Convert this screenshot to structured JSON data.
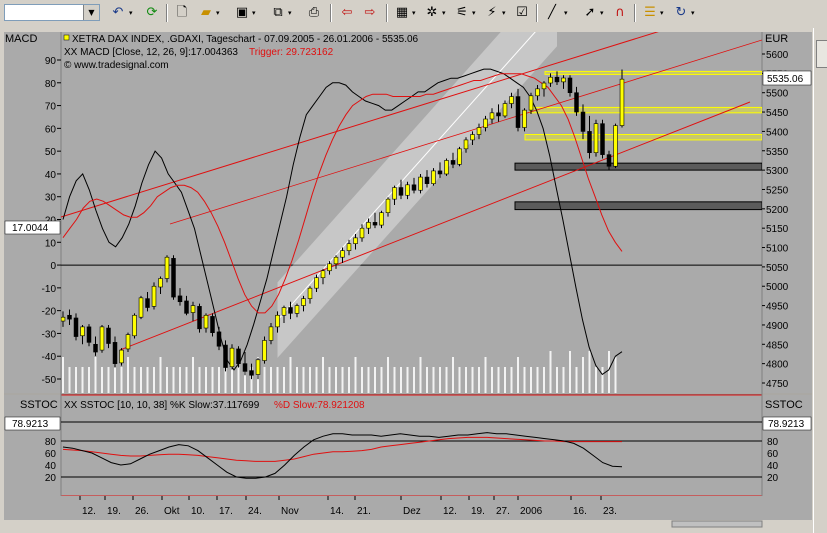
{
  "toolbar": {
    "icons": [
      "undo-icon",
      "refresh-icon",
      "new-document-icon",
      "open-folder-icon",
      "save-disk-icon",
      "copy-icon",
      "print-icon",
      "back-arrow-icon",
      "forward-arrow-icon",
      "chart-type-icon",
      "indicator-icon",
      "drawing-icon",
      "cursor-icon",
      "magnet-icon",
      "options-icon",
      "rotate-icon"
    ]
  },
  "chart_data": [
    {
      "type": "candlestick",
      "title": "XETRA DAX INDEX, .GDAXI, Tageschart - 07.09.2005 - 26.01.2006 - 5535.06",
      "subtitle": "XX MACD [Close, 12, 26, 9]:17.004363",
      "trigger_label": "Trigger: 29.723162",
      "watermark": "© www.tradesignal.com",
      "left_axis_label": "MACD",
      "right_axis_label": "EUR",
      "last_price_label": "5535.06",
      "macd_value_label": "17.0044",
      "left_ticks": [
        "90",
        "80",
        "70",
        "60",
        "50",
        "40",
        "30",
        "20",
        "10",
        "0",
        "-10",
        "-20",
        "-30",
        "-40",
        "-50"
      ],
      "right_ticks": [
        "5600",
        "5550",
        "5500",
        "5450",
        "5400",
        "5350",
        "5300",
        "5250",
        "5200",
        "5150",
        "5100",
        "5050",
        "5000",
        "4950",
        "4900",
        "4850",
        "4800",
        "4750"
      ],
      "ylim_price": [
        4730,
        5620
      ],
      "ylim_macd": [
        -54,
        95
      ],
      "colors": {
        "up": "#ffff00",
        "down": "#000000",
        "macd": "#000000",
        "trigger": "#e01010",
        "trend": "#e01010",
        "channel": "#ffffff",
        "yellow_zone": "#ffff00",
        "dark_zone": "#404040"
      },
      "candles": [
        {
          "o": 4910,
          "h": 4935,
          "l": 4895,
          "c": 4920
        },
        {
          "o": 4925,
          "h": 4940,
          "l": 4900,
          "c": 4915
        },
        {
          "o": 4918,
          "h": 4930,
          "l": 4860,
          "c": 4870
        },
        {
          "o": 4872,
          "h": 4900,
          "l": 4850,
          "c": 4895
        },
        {
          "o": 4895,
          "h": 4902,
          "l": 4845,
          "c": 4855
        },
        {
          "o": 4850,
          "h": 4870,
          "l": 4820,
          "c": 4830
        },
        {
          "o": 4835,
          "h": 4900,
          "l": 4828,
          "c": 4895
        },
        {
          "o": 4892,
          "h": 4900,
          "l": 4840,
          "c": 4852
        },
        {
          "o": 4855,
          "h": 4870,
          "l": 4790,
          "c": 4800
        },
        {
          "o": 4802,
          "h": 4840,
          "l": 4795,
          "c": 4835
        },
        {
          "o": 4838,
          "h": 4880,
          "l": 4830,
          "c": 4875
        },
        {
          "o": 4872,
          "h": 4930,
          "l": 4865,
          "c": 4925
        },
        {
          "o": 4920,
          "h": 4975,
          "l": 4915,
          "c": 4970
        },
        {
          "o": 4968,
          "h": 4985,
          "l": 4935,
          "c": 4945
        },
        {
          "o": 4948,
          "h": 5010,
          "l": 4940,
          "c": 5000
        },
        {
          "o": 4998,
          "h": 5025,
          "l": 4980,
          "c": 5020
        },
        {
          "o": 5020,
          "h": 5080,
          "l": 5010,
          "c": 5075
        },
        {
          "o": 5072,
          "h": 5080,
          "l": 4965,
          "c": 4972
        },
        {
          "o": 4975,
          "h": 4995,
          "l": 4950,
          "c": 4960
        },
        {
          "o": 4962,
          "h": 4975,
          "l": 4925,
          "c": 4930
        },
        {
          "o": 4932,
          "h": 4960,
          "l": 4910,
          "c": 4950
        },
        {
          "o": 4948,
          "h": 4955,
          "l": 4880,
          "c": 4890
        },
        {
          "o": 4892,
          "h": 4930,
          "l": 4880,
          "c": 4925
        },
        {
          "o": 4922,
          "h": 4930,
          "l": 4870,
          "c": 4880
        },
        {
          "o": 4882,
          "h": 4895,
          "l": 4835,
          "c": 4845
        },
        {
          "o": 4848,
          "h": 4860,
          "l": 4780,
          "c": 4790
        },
        {
          "o": 4792,
          "h": 4850,
          "l": 4785,
          "c": 4840
        },
        {
          "o": 4838,
          "h": 4845,
          "l": 4790,
          "c": 4800
        },
        {
          "o": 4800,
          "h": 4830,
          "l": 4770,
          "c": 4780
        },
        {
          "o": 4782,
          "h": 4800,
          "l": 4760,
          "c": 4770
        },
        {
          "o": 4772,
          "h": 4815,
          "l": 4760,
          "c": 4810
        },
        {
          "o": 4808,
          "h": 4870,
          "l": 4800,
          "c": 4860
        },
        {
          "o": 4860,
          "h": 4905,
          "l": 4850,
          "c": 4895
        },
        {
          "o": 4895,
          "h": 4935,
          "l": 4880,
          "c": 4925
        },
        {
          "o": 4925,
          "h": 4950,
          "l": 4905,
          "c": 4945
        },
        {
          "o": 4945,
          "h": 4960,
          "l": 4915,
          "c": 4930
        },
        {
          "o": 4930,
          "h": 4955,
          "l": 4920,
          "c": 4950
        },
        {
          "o": 4950,
          "h": 4975,
          "l": 4935,
          "c": 4968
        },
        {
          "o": 4968,
          "h": 5000,
          "l": 4955,
          "c": 4995
        },
        {
          "o": 4995,
          "h": 5030,
          "l": 4985,
          "c": 5022
        },
        {
          "o": 5022,
          "h": 5045,
          "l": 5005,
          "c": 5040
        },
        {
          "o": 5040,
          "h": 5065,
          "l": 5030,
          "c": 5058
        },
        {
          "o": 5058,
          "h": 5080,
          "l": 5045,
          "c": 5075
        },
        {
          "o": 5075,
          "h": 5100,
          "l": 5060,
          "c": 5092
        },
        {
          "o": 5092,
          "h": 5120,
          "l": 5080,
          "c": 5110
        },
        {
          "o": 5110,
          "h": 5135,
          "l": 5095,
          "c": 5125
        },
        {
          "o": 5125,
          "h": 5160,
          "l": 5115,
          "c": 5150
        },
        {
          "o": 5150,
          "h": 5175,
          "l": 5135,
          "c": 5165
        },
        {
          "o": 5165,
          "h": 5190,
          "l": 5150,
          "c": 5158
        },
        {
          "o": 5158,
          "h": 5195,
          "l": 5150,
          "c": 5190
        },
        {
          "o": 5190,
          "h": 5230,
          "l": 5180,
          "c": 5225
        },
        {
          "o": 5225,
          "h": 5260,
          "l": 5210,
          "c": 5255
        },
        {
          "o": 5255,
          "h": 5275,
          "l": 5225,
          "c": 5235
        },
        {
          "o": 5235,
          "h": 5270,
          "l": 5225,
          "c": 5262
        },
        {
          "o": 5262,
          "h": 5280,
          "l": 5240,
          "c": 5248
        },
        {
          "o": 5248,
          "h": 5290,
          "l": 5240,
          "c": 5282
        },
        {
          "o": 5282,
          "h": 5300,
          "l": 5255,
          "c": 5265
        },
        {
          "o": 5265,
          "h": 5305,
          "l": 5260,
          "c": 5298
        },
        {
          "o": 5298,
          "h": 5320,
          "l": 5280,
          "c": 5290
        },
        {
          "o": 5290,
          "h": 5330,
          "l": 5285,
          "c": 5325
        },
        {
          "o": 5325,
          "h": 5345,
          "l": 5305,
          "c": 5315
        },
        {
          "o": 5315,
          "h": 5360,
          "l": 5310,
          "c": 5355
        },
        {
          "o": 5355,
          "h": 5385,
          "l": 5345,
          "c": 5378
        },
        {
          "o": 5378,
          "h": 5400,
          "l": 5365,
          "c": 5392
        },
        {
          "o": 5392,
          "h": 5420,
          "l": 5380,
          "c": 5410
        },
        {
          "o": 5410,
          "h": 5440,
          "l": 5400,
          "c": 5432
        },
        {
          "o": 5432,
          "h": 5460,
          "l": 5420,
          "c": 5448
        },
        {
          "o": 5448,
          "h": 5470,
          "l": 5425,
          "c": 5440
        },
        {
          "o": 5440,
          "h": 5480,
          "l": 5435,
          "c": 5472
        },
        {
          "o": 5472,
          "h": 5500,
          "l": 5460,
          "c": 5490
        },
        {
          "o": 5490,
          "h": 5510,
          "l": 5400,
          "c": 5410
        },
        {
          "o": 5410,
          "h": 5460,
          "l": 5400,
          "c": 5455
        },
        {
          "o": 5455,
          "h": 5500,
          "l": 5445,
          "c": 5492
        },
        {
          "o": 5492,
          "h": 5520,
          "l": 5480,
          "c": 5510
        },
        {
          "o": 5510,
          "h": 5530,
          "l": 5490,
          "c": 5525
        },
        {
          "o": 5525,
          "h": 5550,
          "l": 5515,
          "c": 5540
        },
        {
          "o": 5540,
          "h": 5555,
          "l": 5520,
          "c": 5528
        },
        {
          "o": 5528,
          "h": 5545,
          "l": 5510,
          "c": 5538
        },
        {
          "o": 5538,
          "h": 5545,
          "l": 5490,
          "c": 5500
        },
        {
          "o": 5500,
          "h": 5515,
          "l": 5440,
          "c": 5450
        },
        {
          "o": 5450,
          "h": 5470,
          "l": 5380,
          "c": 5400
        },
        {
          "o": 5400,
          "h": 5440,
          "l": 5330,
          "c": 5345
        },
        {
          "o": 5345,
          "h": 5430,
          "l": 5335,
          "c": 5420
        },
        {
          "o": 5420,
          "h": 5430,
          "l": 5330,
          "c": 5340
        },
        {
          "o": 5340,
          "h": 5350,
          "l": 5300,
          "c": 5310
        },
        {
          "o": 5310,
          "h": 5420,
          "l": 5305,
          "c": 5415
        },
        {
          "o": 5415,
          "h": 5560,
          "l": 5410,
          "c": 5535
        }
      ],
      "macd": [
        20,
        30,
        37,
        40,
        33,
        24,
        16,
        10,
        8,
        12,
        18,
        26,
        36,
        44,
        50,
        47,
        40,
        36,
        32,
        24,
        16,
        4,
        -8,
        -20,
        -32,
        -42,
        -46,
        -42,
        -35,
        -26,
        -16,
        -6,
        6,
        18,
        30,
        44,
        56,
        66,
        70,
        74,
        78,
        80,
        80,
        79,
        76,
        74,
        72,
        71,
        70,
        68,
        68,
        70,
        72,
        74,
        76,
        76,
        78,
        80,
        81,
        82,
        82,
        83,
        84,
        85,
        86,
        86,
        85,
        84,
        82,
        80,
        78,
        74,
        68,
        60,
        48,
        34,
        20,
        5,
        -10,
        -24,
        -36,
        -44,
        -48,
        -46,
        -40,
        -38
      ],
      "trigger": [
        12,
        16,
        20,
        25,
        28,
        29,
        28,
        26,
        24,
        22,
        21,
        21,
        23,
        26,
        30,
        32,
        34,
        35,
        35,
        34,
        32,
        28,
        23,
        17,
        10,
        2,
        -6,
        -13,
        -18,
        -21,
        -21,
        -18,
        -13,
        -6,
        2,
        11,
        21,
        31,
        40,
        48,
        55,
        61,
        66,
        70,
        72,
        74,
        75,
        75,
        75,
        74,
        74,
        74,
        74,
        74,
        75,
        75,
        76,
        77,
        78,
        79,
        80,
        81,
        81,
        82,
        83,
        84,
        84,
        84,
        84,
        83,
        82,
        80,
        78,
        74,
        70,
        64,
        56,
        47,
        38,
        30,
        22,
        15,
        10,
        6
      ],
      "volume": [
        30,
        30,
        30,
        30,
        30,
        30,
        30,
        30,
        30,
        30,
        30,
        30,
        30,
        30,
        30,
        30,
        30,
        30,
        30,
        30,
        30,
        30,
        30,
        30,
        30,
        30,
        30,
        30,
        30,
        30,
        30,
        30,
        30,
        30,
        30,
        30,
        30,
        30,
        30,
        30,
        30,
        30,
        30,
        30,
        30,
        30,
        30,
        30,
        30,
        30,
        30,
        30,
        30,
        30,
        30,
        30,
        30,
        30,
        30,
        30,
        30,
        30,
        30,
        30,
        30,
        30,
        30,
        30,
        30,
        30,
        30,
        30,
        30,
        30,
        30,
        30,
        30,
        30,
        30,
        30,
        30,
        30,
        30,
        30,
        30,
        30
      ],
      "horizontal_zones": [
        {
          "kind": "yellow",
          "price_top": 5555,
          "price_bottom": 5550
        },
        {
          "kind": "yellow",
          "price_top": 5462,
          "price_bottom": 5448
        },
        {
          "kind": "yellow",
          "price_top": 5392,
          "price_bottom": 5378
        },
        {
          "kind": "dark",
          "price_top": 5318,
          "price_bottom": 5300
        },
        {
          "kind": "dark",
          "price_top": 5218,
          "price_bottom": 5198
        }
      ]
    },
    {
      "type": "line",
      "title": "XX SSTOC [10, 10, 38] %K Slow:37.117699",
      "d_label": "%D Slow:78.921208",
      "left_axis_label": "SSTOC",
      "right_axis_label": "SSTOC",
      "value_label": "78.9213",
      "ticks": [
        "80",
        "60",
        "40",
        "20"
      ],
      "ylim": [
        0,
        100
      ],
      "k_slow": [
        70,
        68,
        64,
        60,
        52,
        44,
        40,
        42,
        50,
        58,
        64,
        70,
        74,
        72,
        64,
        52,
        40,
        28,
        20,
        18,
        18,
        20,
        26,
        40,
        56,
        70,
        82,
        88,
        92,
        92,
        90,
        90,
        90,
        88,
        90,
        92,
        90,
        88,
        88,
        86,
        88,
        90,
        90,
        92,
        94,
        92,
        92,
        90,
        88,
        86,
        84,
        82,
        80,
        76,
        68,
        56,
        44,
        38,
        37
      ],
      "d_slow": [
        66,
        65,
        64,
        62,
        60,
        58,
        56,
        55,
        55,
        56,
        57,
        58,
        58,
        57,
        56,
        54,
        52,
        50,
        48,
        47,
        46,
        46,
        46,
        48,
        50,
        54,
        58,
        60,
        62,
        62,
        63,
        64,
        66,
        70,
        72,
        74,
        76,
        78,
        80,
        82,
        84,
        85,
        86,
        86,
        86,
        85,
        84,
        83,
        82,
        81,
        80,
        80,
        79,
        79,
        79,
        79,
        79,
        79,
        79
      ]
    }
  ],
  "x_axis_labels": [
    "12.",
    "19.",
    "26.",
    "Okt",
    "10.",
    "17.",
    "24.",
    "Nov",
    "14.",
    "21.",
    "Dez",
    "12.",
    "19.",
    "27.",
    "2006",
    "16.",
    "23."
  ]
}
